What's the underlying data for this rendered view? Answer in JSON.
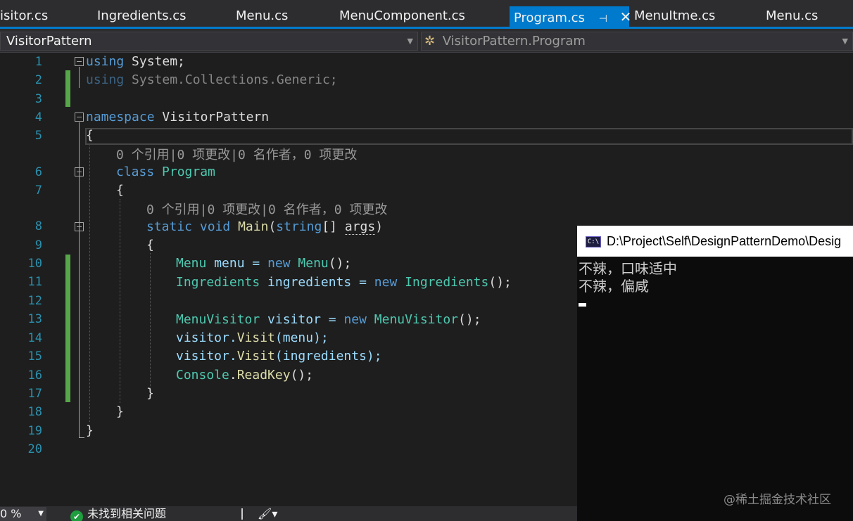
{
  "tabs": [
    {
      "label": "isitor.cs",
      "active": false
    },
    {
      "label": "Ingredients.cs",
      "active": false
    },
    {
      "label": "Menu.cs",
      "active": false
    },
    {
      "label": "MenuComponent.cs",
      "active": false
    },
    {
      "label": "Program.cs",
      "active": true
    },
    {
      "label": "MenuItme.cs",
      "active": false
    },
    {
      "label": "Menu.cs",
      "active": false
    }
  ],
  "navbar": {
    "project": "VisitorPattern",
    "class_member": "VisitorPattern.Program"
  },
  "editor": {
    "line_numbers": [
      "1",
      "2",
      "3",
      "4",
      "5",
      "6",
      "7",
      "8",
      "9",
      "10",
      "11",
      "12",
      "13",
      "14",
      "15",
      "16",
      "17",
      "18",
      "19",
      "20"
    ],
    "lens_class": "0 个引用|0 项更改|0 名作者，0 项更改",
    "lens_method": "0 个引用|0 项更改|0 名作者，0 项更改",
    "tokens": {
      "using": "using",
      "system": "System;",
      "system_generic": "System.Collections.Generic;",
      "namespace": "namespace",
      "ns_name": "VisitorPattern",
      "open_brace": "{",
      "close_brace": "}",
      "class": "class",
      "program": "Program",
      "static": "static",
      "void": "void",
      "main": "Main",
      "lparen": "(",
      "string": "string",
      "brackets": "[] ",
      "args": "args",
      "rparen": ")",
      "menu_type": "Menu",
      "menu_var": " menu = ",
      "new": "new",
      "menu_ctor_end": "();",
      "ingredients_type": "Ingredients",
      "ingredients_var": " ingredients = ",
      "visitor_type": "MenuVisitor",
      "visitor_var": " visitor = ",
      "visitor": "visitor.",
      "visit": "Visit",
      "visit_menu_arg": "(menu);",
      "visit_ingr_arg": "(ingredients);",
      "console": "Console",
      "dot": ".",
      "readkey": "ReadKey",
      "readkey_end": "();"
    }
  },
  "console": {
    "title": "D:\\Project\\Self\\DesignPatternDemo\\Desig",
    "icon_text": "C:\\",
    "output": [
      "不辣，口味适中",
      "不辣，偏咸"
    ],
    "watermark": "@稀土掘金技术社区"
  },
  "statusbar": {
    "zoom": "0 %",
    "issues": "未找到相关问题",
    "ok_icon": "✔",
    "brush_icon": "🖌▾"
  },
  "icons": {
    "pin": "⊣",
    "close": "✕",
    "dropdown": "▼"
  }
}
